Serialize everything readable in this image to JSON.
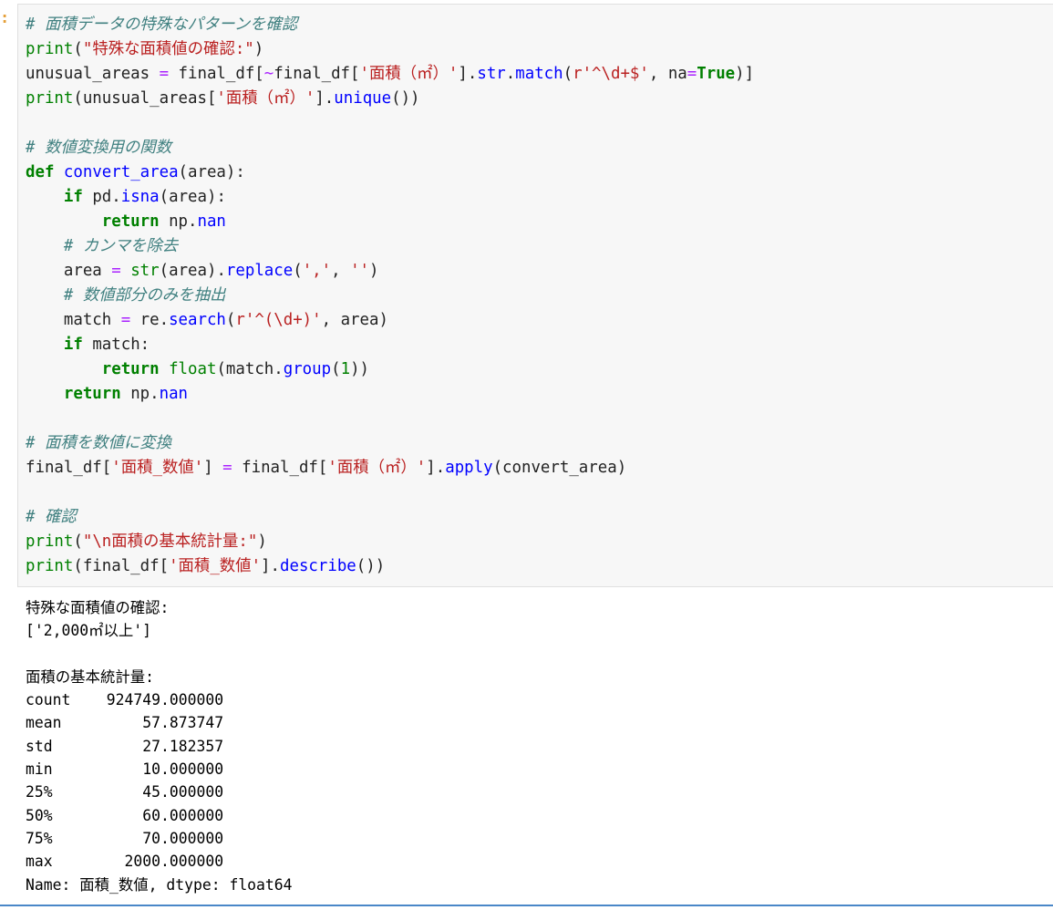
{
  "cell": {
    "prompt_symbol": ":",
    "code_lines": [
      [
        {
          "t": "# 面積データの特殊なパターンを確認",
          "c": "c"
        }
      ],
      [
        {
          "t": "print",
          "c": "b"
        },
        {
          "t": "(",
          "c": ""
        },
        {
          "t": "\"特殊な面積値の確認:\"",
          "c": "s"
        },
        {
          "t": ")",
          "c": ""
        }
      ],
      [
        {
          "t": "unusual_areas ",
          "c": ""
        },
        {
          "t": "=",
          "c": "o"
        },
        {
          "t": " final_df[",
          "c": ""
        },
        {
          "t": "~",
          "c": "o"
        },
        {
          "t": "final_df[",
          "c": ""
        },
        {
          "t": "'面積（㎡）'",
          "c": "s"
        },
        {
          "t": "].",
          "c": ""
        },
        {
          "t": "str",
          "c": "f"
        },
        {
          "t": ".",
          "c": ""
        },
        {
          "t": "match",
          "c": "f"
        },
        {
          "t": "(",
          "c": ""
        },
        {
          "t": "r'^\\d+$'",
          "c": "s"
        },
        {
          "t": ", na",
          "c": ""
        },
        {
          "t": "=",
          "c": "o"
        },
        {
          "t": "True",
          "c": "k"
        },
        {
          "t": ")]",
          "c": ""
        }
      ],
      [
        {
          "t": "print",
          "c": "b"
        },
        {
          "t": "(unusual_areas[",
          "c": ""
        },
        {
          "t": "'面積（㎡）'",
          "c": "s"
        },
        {
          "t": "].",
          "c": ""
        },
        {
          "t": "unique",
          "c": "f"
        },
        {
          "t": "())",
          "c": ""
        }
      ],
      [],
      [
        {
          "t": "# 数値変換用の関数",
          "c": "c"
        }
      ],
      [
        {
          "t": "def",
          "c": "k"
        },
        {
          "t": " ",
          "c": ""
        },
        {
          "t": "convert_area",
          "c": "f"
        },
        {
          "t": "(area):",
          "c": ""
        }
      ],
      [
        {
          "t": "    ",
          "c": ""
        },
        {
          "t": "if",
          "c": "k"
        },
        {
          "t": " pd.",
          "c": ""
        },
        {
          "t": "isna",
          "c": "f"
        },
        {
          "t": "(area):",
          "c": ""
        }
      ],
      [
        {
          "t": "        ",
          "c": ""
        },
        {
          "t": "return",
          "c": "k"
        },
        {
          "t": " np.",
          "c": ""
        },
        {
          "t": "nan",
          "c": "f"
        }
      ],
      [
        {
          "t": "    ",
          "c": ""
        },
        {
          "t": "# カンマを除去",
          "c": "c"
        }
      ],
      [
        {
          "t": "    area ",
          "c": ""
        },
        {
          "t": "=",
          "c": "o"
        },
        {
          "t": " ",
          "c": ""
        },
        {
          "t": "str",
          "c": "b"
        },
        {
          "t": "(area).",
          "c": ""
        },
        {
          "t": "replace",
          "c": "f"
        },
        {
          "t": "(",
          "c": ""
        },
        {
          "t": "','",
          "c": "s"
        },
        {
          "t": ", ",
          "c": ""
        },
        {
          "t": "''",
          "c": "s"
        },
        {
          "t": ")",
          "c": ""
        }
      ],
      [
        {
          "t": "    ",
          "c": ""
        },
        {
          "t": "# 数値部分のみを抽出",
          "c": "c"
        }
      ],
      [
        {
          "t": "    match ",
          "c": ""
        },
        {
          "t": "=",
          "c": "o"
        },
        {
          "t": " re.",
          "c": ""
        },
        {
          "t": "search",
          "c": "f"
        },
        {
          "t": "(",
          "c": ""
        },
        {
          "t": "r'^(\\d+)'",
          "c": "s"
        },
        {
          "t": ", area)",
          "c": ""
        }
      ],
      [
        {
          "t": "    ",
          "c": ""
        },
        {
          "t": "if",
          "c": "k"
        },
        {
          "t": " match:",
          "c": ""
        }
      ],
      [
        {
          "t": "        ",
          "c": ""
        },
        {
          "t": "return",
          "c": "k"
        },
        {
          "t": " ",
          "c": ""
        },
        {
          "t": "float",
          "c": "b"
        },
        {
          "t": "(match.",
          "c": ""
        },
        {
          "t": "group",
          "c": "f"
        },
        {
          "t": "(",
          "c": ""
        },
        {
          "t": "1",
          "c": "n"
        },
        {
          "t": "))",
          "c": ""
        }
      ],
      [
        {
          "t": "    ",
          "c": ""
        },
        {
          "t": "return",
          "c": "k"
        },
        {
          "t": " np.",
          "c": ""
        },
        {
          "t": "nan",
          "c": "f"
        }
      ],
      [],
      [
        {
          "t": "# 面積を数値に変換",
          "c": "c"
        }
      ],
      [
        {
          "t": "final_df[",
          "c": ""
        },
        {
          "t": "'面積_数値'",
          "c": "s"
        },
        {
          "t": "] ",
          "c": ""
        },
        {
          "t": "=",
          "c": "o"
        },
        {
          "t": " final_df[",
          "c": ""
        },
        {
          "t": "'面積（㎡）'",
          "c": "s"
        },
        {
          "t": "].",
          "c": ""
        },
        {
          "t": "apply",
          "c": "f"
        },
        {
          "t": "(convert_area)",
          "c": ""
        }
      ],
      [],
      [
        {
          "t": "# 確認",
          "c": "c"
        }
      ],
      [
        {
          "t": "print",
          "c": "b"
        },
        {
          "t": "(",
          "c": ""
        },
        {
          "t": "\"\\n面積の基本統計量:\"",
          "c": "s"
        },
        {
          "t": ")",
          "c": ""
        }
      ],
      [
        {
          "t": "print",
          "c": "b"
        },
        {
          "t": "(final_df[",
          "c": ""
        },
        {
          "t": "'面積_数値'",
          "c": "s"
        },
        {
          "t": "].",
          "c": ""
        },
        {
          "t": "describe",
          "c": "f"
        },
        {
          "t": "())",
          "c": ""
        }
      ]
    ]
  },
  "output": {
    "lines": [
      "特殊な面積値の確認:",
      "['2,000㎡以上']",
      "",
      "面積の基本統計量:",
      "count    924749.000000",
      "mean         57.873747",
      "std          27.182357",
      "min          10.000000",
      "25%          45.000000",
      "50%          60.000000",
      "75%          70.000000",
      "max        2000.000000",
      "Name: 面積_数値, dtype: float64"
    ]
  },
  "colors": {
    "comment": "#408080",
    "keyword": "#008000",
    "string": "#ba2121",
    "function": "#0000ff",
    "operator": "#aa22ff",
    "prompt": "#e5a03a",
    "cell_border": "#4a87c8"
  }
}
